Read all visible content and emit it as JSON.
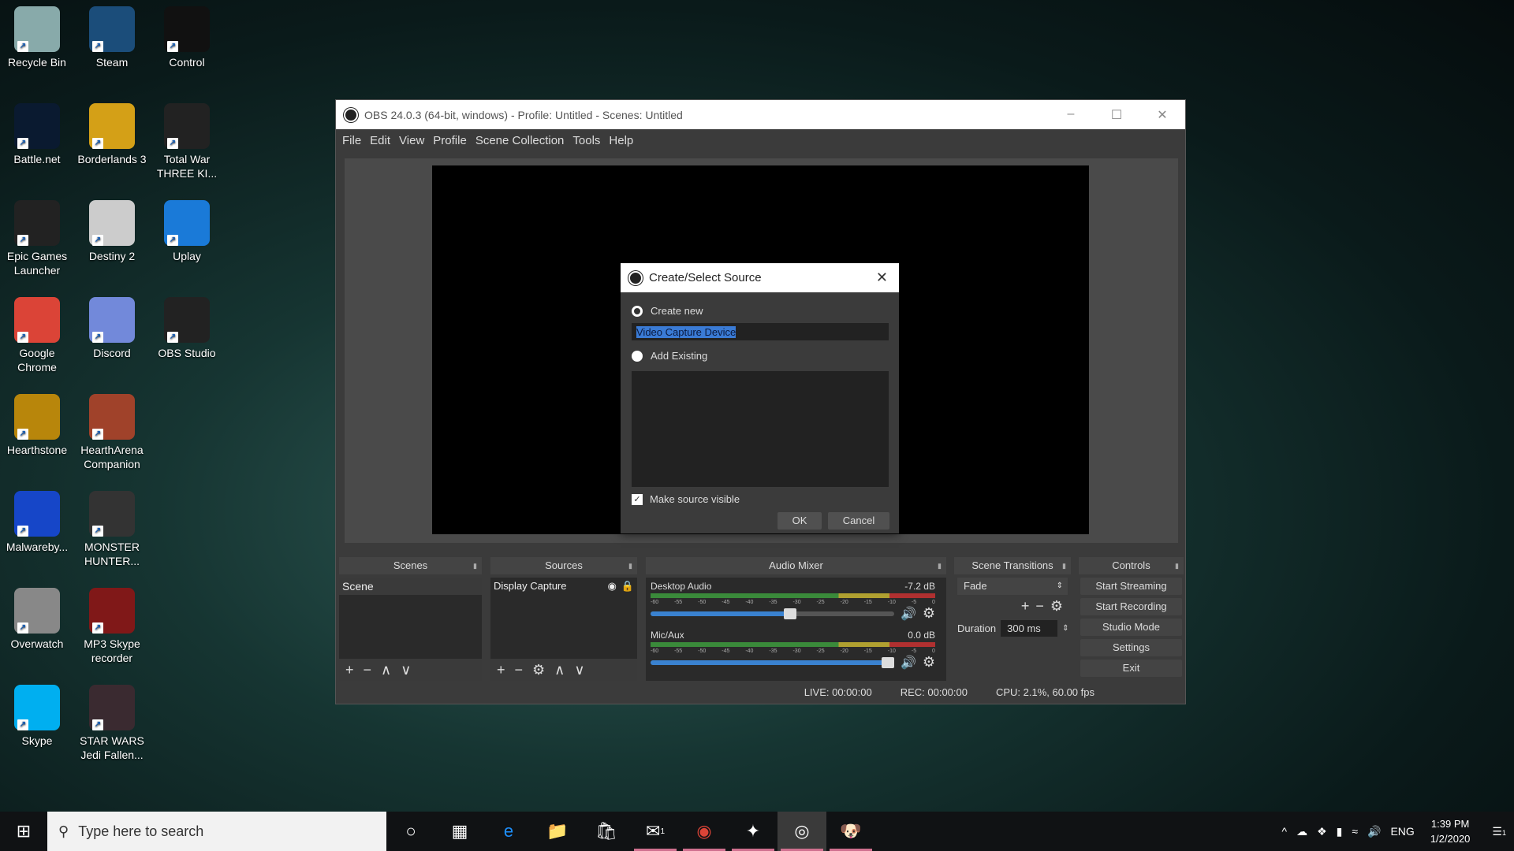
{
  "desktop": {
    "icons": [
      {
        "label": "Recycle Bin",
        "color": "#8aa"
      },
      {
        "label": "Steam",
        "color": "#1b4d7a"
      },
      {
        "label": "Control",
        "color": "#111"
      },
      {
        "label": "Battle.net",
        "color": "#0a1a30"
      },
      {
        "label": "Borderlands 3",
        "color": "#d4a017"
      },
      {
        "label": "Total War THREE KI...",
        "color": "#222"
      },
      {
        "label": "Epic Games Launcher",
        "color": "#222"
      },
      {
        "label": "Destiny 2",
        "color": "#ccc"
      },
      {
        "label": "Uplay",
        "color": "#1a7ad8"
      },
      {
        "label": "Google Chrome",
        "color": "#db4437"
      },
      {
        "label": "Discord",
        "color": "#7289da"
      },
      {
        "label": "OBS Studio",
        "color": "#222"
      },
      {
        "label": "Hearthstone",
        "color": "#b8860b"
      },
      {
        "label": "HearthArena Companion",
        "color": "#a0422a"
      },
      {
        "label": "Malwareby...",
        "color": "#1646c8"
      },
      {
        "label": "MONSTER HUNTER...",
        "color": "#333"
      },
      {
        "label": "Overwatch",
        "color": "#888"
      },
      {
        "label": "MP3 Skype recorder",
        "color": "#801818"
      },
      {
        "label": "Skype",
        "color": "#00aff0"
      },
      {
        "label": "STAR WARS Jedi Fallen...",
        "color": "#3a2a30"
      }
    ]
  },
  "obs": {
    "title": "OBS 24.0.3 (64-bit, windows) - Profile: Untitled - Scenes: Untitled",
    "menu": [
      "File",
      "Edit",
      "View",
      "Profile",
      "Scene Collection",
      "Tools",
      "Help"
    ],
    "docks": {
      "scenes": {
        "title": "Scenes",
        "items": [
          "Scene"
        ]
      },
      "sources": {
        "title": "Sources",
        "items": [
          "Display Capture"
        ]
      },
      "mixer": {
        "title": "Audio Mixer",
        "channels": [
          {
            "name": "Desktop Audio",
            "db": "-7.2 dB",
            "volume": 0.6
          },
          {
            "name": "Mic/Aux",
            "db": "0.0 dB",
            "volume": 1.0
          }
        ],
        "ticks": [
          "-60",
          "-55",
          "-50",
          "-45",
          "-40",
          "-35",
          "-30",
          "-25",
          "-20",
          "-15",
          "-10",
          "-5",
          "0"
        ]
      },
      "transitions": {
        "title": "Scene Transitions",
        "selected": "Fade",
        "duration_label": "Duration",
        "duration": "300 ms"
      },
      "controls": {
        "title": "Controls",
        "buttons": [
          "Start Streaming",
          "Start Recording",
          "Studio Mode",
          "Settings",
          "Exit"
        ]
      }
    },
    "status": {
      "live": "LIVE: 00:00:00",
      "rec": "REC: 00:00:00",
      "cpu": "CPU: 2.1%, 60.00 fps"
    }
  },
  "dialog": {
    "title": "Create/Select Source",
    "create_new": "Create new",
    "name_value": "Video Capture Device",
    "add_existing": "Add Existing",
    "make_visible": "Make source visible",
    "make_visible_checked": true,
    "ok": "OK",
    "cancel": "Cancel"
  },
  "taskbar": {
    "search_placeholder": "Type here to search",
    "time": "1:39 PM",
    "date": "1/2/2020",
    "lang": "ENG",
    "mail_badge": "1",
    "notif_badge": "1"
  }
}
